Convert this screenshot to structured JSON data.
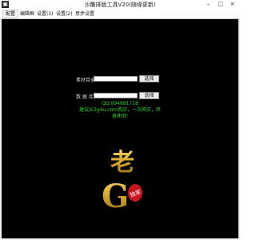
{
  "window": {
    "title": "沙雕排版工具V20(随缘更新)",
    "icon": "app-icon",
    "buttons": {
      "minimize": "–",
      "maximize": "□",
      "close": "×"
    }
  },
  "menu": {
    "items": [
      "配置",
      "编辑框",
      "设置(1)",
      "设置(2)",
      "意步设置"
    ]
  },
  "form": {
    "row1": {
      "label": "素材目录",
      "value": "",
      "button": "选择"
    },
    "row2": {
      "label": "数 据 库",
      "value": "",
      "button": "选择"
    }
  },
  "info": {
    "qq": "QQ:994881718",
    "line1": "建议从3g4u.com购买，一次购买，终",
    "line2": "身使用!"
  },
  "logo": {
    "char_top": "老",
    "char_big": "G",
    "seal": "独家",
    "gold_color": "#d4a52a",
    "seal_color": "#c8141e"
  }
}
